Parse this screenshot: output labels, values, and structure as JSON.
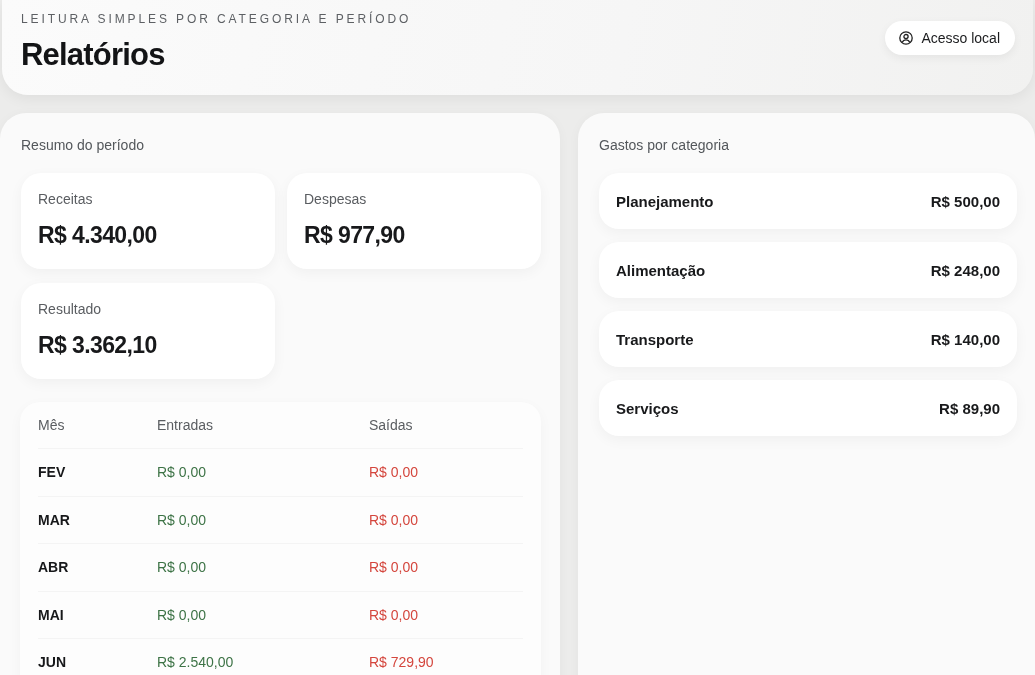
{
  "header": {
    "eyebrow": "LEITURA SIMPLES POR CATEGORIA E PERÍODO",
    "title": "Relatórios",
    "access_button": {
      "label": "Acesso local"
    }
  },
  "summary": {
    "title": "Resumo do período",
    "cards": [
      {
        "label": "Receitas",
        "value": "R$ 4.340,00"
      },
      {
        "label": "Despesas",
        "value": "R$ 977,90"
      },
      {
        "label": "Resultado",
        "value": "R$ 3.362,10"
      }
    ],
    "table": {
      "columns": [
        "Mês",
        "Entradas",
        "Saídas"
      ],
      "rows": [
        {
          "month": "FEV",
          "income": "R$ 0,00",
          "expense": "R$ 0,00"
        },
        {
          "month": "MAR",
          "income": "R$ 0,00",
          "expense": "R$ 0,00"
        },
        {
          "month": "ABR",
          "income": "R$ 0,00",
          "expense": "R$ 0,00"
        },
        {
          "month": "MAI",
          "income": "R$ 0,00",
          "expense": "R$ 0,00"
        },
        {
          "month": "JUN",
          "income": "R$ 2.540,00",
          "expense": "R$ 729,90"
        }
      ]
    }
  },
  "categories": {
    "title": "Gastos por categoria",
    "items": [
      {
        "name": "Planejamento",
        "amount": "R$ 500,00"
      },
      {
        "name": "Alimentação",
        "amount": "R$ 248,00"
      },
      {
        "name": "Transporte",
        "amount": "R$ 140,00"
      },
      {
        "name": "Serviços",
        "amount": "R$ 89,90"
      }
    ]
  }
}
